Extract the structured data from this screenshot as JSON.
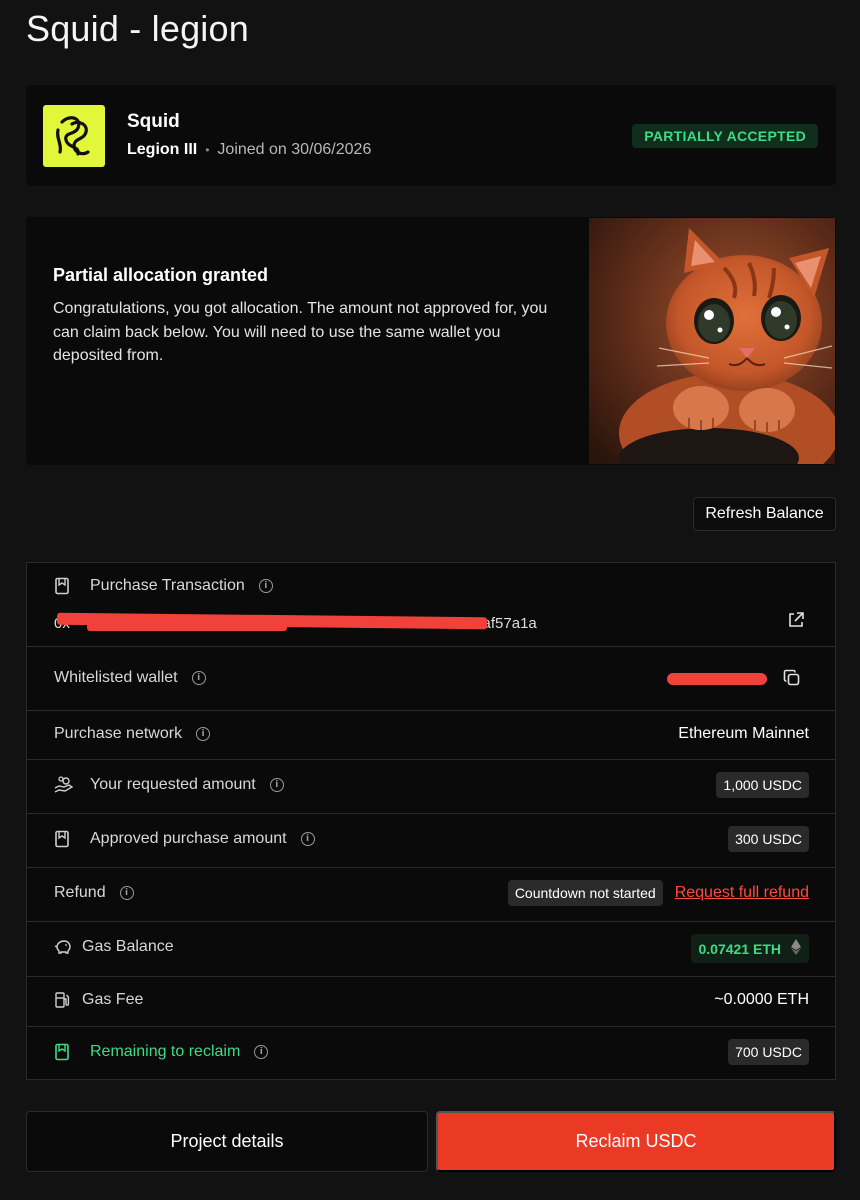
{
  "page": {
    "title": "Squid - legion"
  },
  "header": {
    "project_name": "Squid",
    "tier": "Legion III",
    "joined": "Joined on 30/06/2026",
    "status": "PARTIALLY ACCEPTED",
    "colors": {
      "logo_bg": "#e3f73a",
      "status_fg": "#3ddc84",
      "status_bg": "#0f2e1c"
    }
  },
  "notice": {
    "title": "Partial allocation granted",
    "body": "Congratulations, you got allocation. The amount not approved for, you can claim back below. You will need to use the same wallet you deposited from."
  },
  "refresh_label": "Refresh Balance",
  "details": {
    "purchase_transaction": {
      "label": "Purchase Transaction",
      "hash_visible": "0x                                                                     41088b5e6d47049af57a1a"
    },
    "whitelisted_wallet": {
      "label": "Whitelisted wallet"
    },
    "purchase_network": {
      "label": "Purchase network",
      "value": "Ethereum Mainnet"
    },
    "requested_amount": {
      "label": "Your requested amount",
      "value": "1,000 USDC"
    },
    "approved_amount": {
      "label": "Approved purchase amount",
      "value": "300 USDC"
    },
    "refund": {
      "label": "Refund",
      "status": "Countdown not started",
      "link": "Request full refund"
    },
    "gas_balance": {
      "label": "Gas Balance",
      "value": "0.07421 ETH"
    },
    "gas_fee": {
      "label": "Gas Fee",
      "value": "~0.0000 ETH"
    },
    "remaining": {
      "label": "Remaining to reclaim",
      "value": "700 USDC"
    }
  },
  "buttons": {
    "project_details": "Project details",
    "reclaim": "Reclaim USDC"
  },
  "icons": [
    "squid-logo-icon",
    "receipt-icon",
    "info-icon",
    "external-link-icon",
    "copy-icon",
    "hand-coins-icon",
    "piggy-bank-icon",
    "fuel-pump-icon",
    "ethereum-icon"
  ],
  "accent_colors": {
    "primary": "#ea3a26",
    "success": "#3ddc84",
    "redaction": "#f0413a"
  }
}
